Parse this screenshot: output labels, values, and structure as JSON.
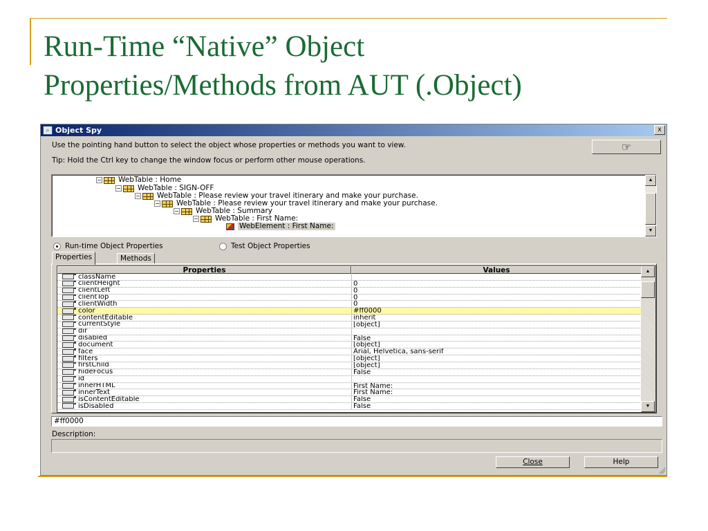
{
  "slide": {
    "title_line1": "Run-Time “Native” Object",
    "title_line2": "Properties/Methods  from AUT (.Object)"
  },
  "window": {
    "title": "Object Spy",
    "close_glyph": "x",
    "instruction": "Use the pointing hand button to select the object whose properties or methods you want to view.",
    "tip": "Tip: Hold the Ctrl key to change the window focus or perform other mouse operations.",
    "hand_button_glyph": "☞"
  },
  "tree": {
    "items": [
      {
        "label": "WebTable : Home",
        "icon": "table-icon",
        "expander": "−"
      },
      {
        "label": "WebTable : SIGN-OFF",
        "icon": "table-icon",
        "expander": "−"
      },
      {
        "label": "WebTable : Please review your travel itinerary and make your purchase.",
        "icon": "table-icon",
        "expander": "−"
      },
      {
        "label": "WebTable : Please review your travel itinerary and make your purchase.",
        "icon": "table-icon",
        "expander": "−"
      },
      {
        "label": "WebTable : Summary",
        "icon": "table-icon",
        "expander": "−"
      },
      {
        "label": "WebTable : First Name:",
        "icon": "table-icon",
        "expander": "−"
      },
      {
        "label": "WebElement : First Name:",
        "icon": "web-element-icon",
        "selected": true
      }
    ]
  },
  "radio": {
    "runtime_label": "Run-time Object Properties",
    "test_label": "Test Object Properties",
    "selected": "runtime"
  },
  "tabs": {
    "properties": "Properties",
    "methods": "Methods",
    "active": "properties"
  },
  "grid": {
    "headers": {
      "properties": "Properties",
      "values": "Values"
    },
    "rows": [
      {
        "name": "className",
        "value": ""
      },
      {
        "name": "clientHeight",
        "value": "0"
      },
      {
        "name": "clientLeft",
        "value": "0"
      },
      {
        "name": "clientTop",
        "value": "0"
      },
      {
        "name": "clientWidth",
        "value": "0"
      },
      {
        "name": "color",
        "value": "#ff0000",
        "highlight": true
      },
      {
        "name": "contentEditable",
        "value": "inherit"
      },
      {
        "name": "currentStyle",
        "value": "[object]"
      },
      {
        "name": "dir",
        "value": ""
      },
      {
        "name": "disabled",
        "value": "False"
      },
      {
        "name": "document",
        "value": "[object]"
      },
      {
        "name": "face",
        "value": "Arial, Helvetica, sans-serif"
      },
      {
        "name": "filters",
        "value": "[object]"
      },
      {
        "name": "firstChild",
        "value": "[object]"
      },
      {
        "name": "hideFocus",
        "value": "False"
      },
      {
        "name": "id",
        "value": ""
      },
      {
        "name": "innerHTML",
        "value": "First Name:"
      },
      {
        "name": "innerText",
        "value": "First Name:"
      },
      {
        "name": "isContentEditable",
        "value": "False"
      },
      {
        "name": "isDisabled",
        "value": "False"
      }
    ]
  },
  "value_field": "#ff0000",
  "description_label": "Description:",
  "buttons": {
    "close": "Close",
    "help": "Help"
  },
  "colors": {
    "title_green": "#1a6b34",
    "accent_gold": "#d4a017",
    "highlight_row": "#fff8a8",
    "titlebar_start": "#0a246a",
    "titlebar_end": "#a6caf0"
  }
}
